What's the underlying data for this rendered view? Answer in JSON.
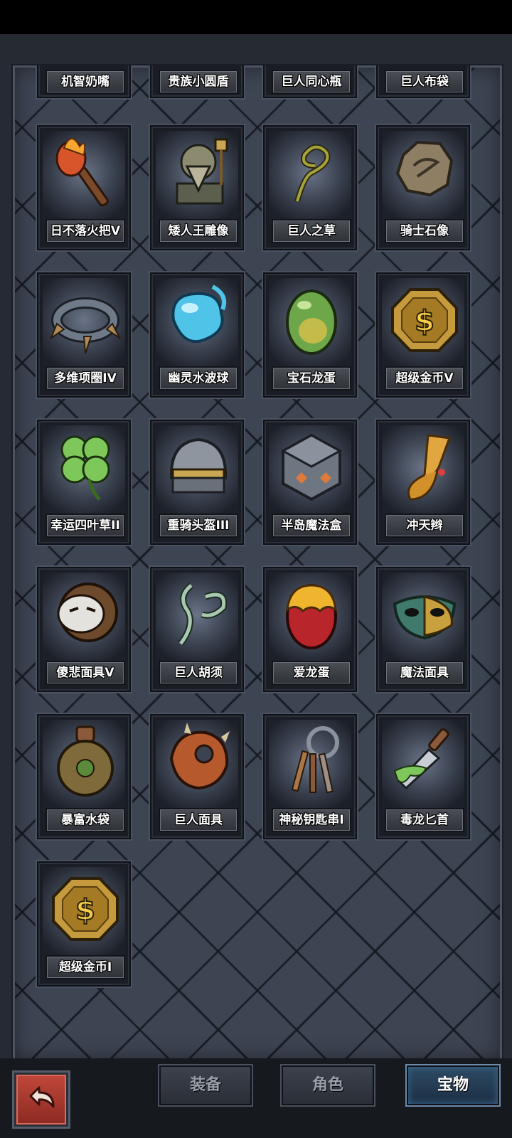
{
  "inventory": {
    "partial_row": [
      "机智奶嘴",
      "贵族小圆盾",
      "巨人同心瓶",
      "巨人布袋"
    ],
    "items": [
      {
        "label": "日不落火把V",
        "icon": "torch-icon"
      },
      {
        "label": "矮人王雕像",
        "icon": "dwarf-king-statue-icon"
      },
      {
        "label": "巨人之草",
        "icon": "giant-grass-icon"
      },
      {
        "label": "骑士石像",
        "icon": "knight-stone-statue-icon"
      },
      {
        "label": "多维项圈IV",
        "icon": "spiked-collar-icon"
      },
      {
        "label": "幽灵水波球",
        "icon": "water-orb-icon"
      },
      {
        "label": "宝石龙蛋",
        "icon": "gem-dragon-egg-icon"
      },
      {
        "label": "超级金币V",
        "icon": "gold-coin-icon"
      },
      {
        "label": "幸运四叶草II",
        "icon": "four-leaf-clover-icon"
      },
      {
        "label": "重骑头盔III",
        "icon": "knight-helmet-icon"
      },
      {
        "label": "半岛魔法盒",
        "icon": "magic-cube-icon"
      },
      {
        "label": "冲天辫",
        "icon": "ponytail-icon"
      },
      {
        "label": "傻悲面具V",
        "icon": "sad-mask-icon"
      },
      {
        "label": "巨人胡须",
        "icon": "giant-beard-icon"
      },
      {
        "label": "爱龙蛋",
        "icon": "red-dragon-egg-icon"
      },
      {
        "label": "魔法面具",
        "icon": "masquerade-mask-icon"
      },
      {
        "label": "暴富水袋",
        "icon": "water-flask-icon"
      },
      {
        "label": "巨人面具",
        "icon": "giant-mask-icon"
      },
      {
        "label": "神秘钥匙串I",
        "icon": "key-ring-icon"
      },
      {
        "label": "毒龙匕首",
        "icon": "poison-dagger-icon"
      },
      {
        "label": "超级金币I",
        "icon": "gold-coin-icon"
      }
    ]
  },
  "tabs": [
    {
      "label": "装备",
      "active": false
    },
    {
      "label": "角色",
      "active": false
    },
    {
      "label": "宝物",
      "active": true
    }
  ],
  "back_icon": "back-arrow-icon"
}
